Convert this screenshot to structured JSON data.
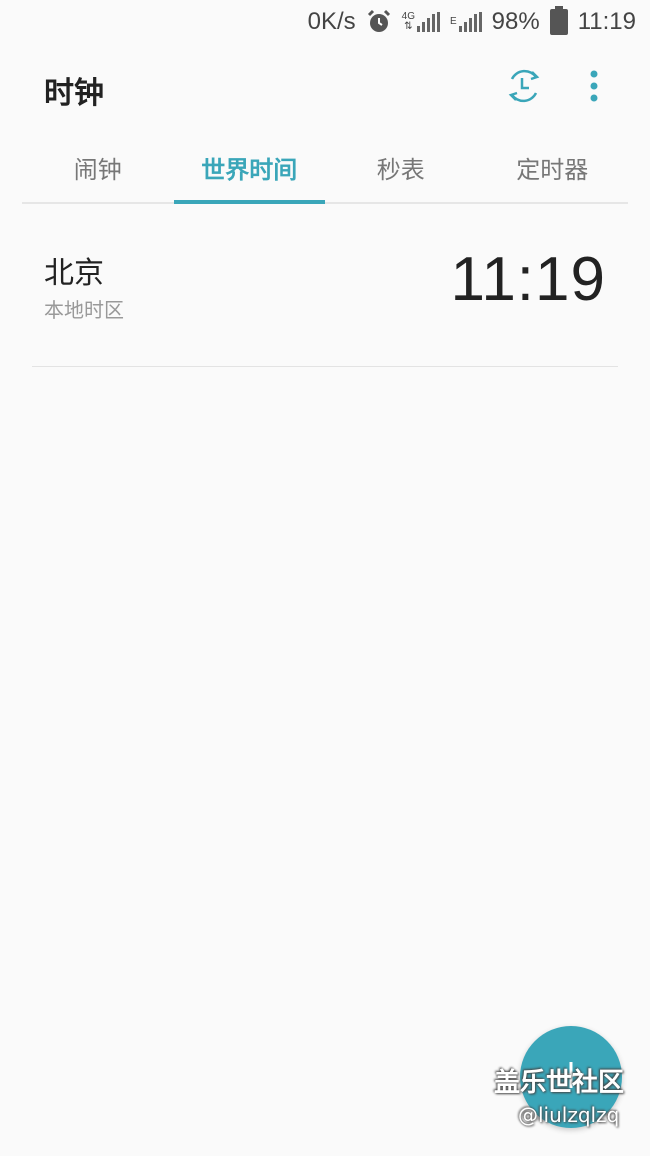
{
  "status_bar": {
    "net_speed": "0K/s",
    "network_4g": "4G",
    "network_e": "E",
    "battery": "98%",
    "time": "11:19"
  },
  "app_bar": {
    "title": "时钟"
  },
  "tabs": [
    {
      "label": "闹钟",
      "active": false
    },
    {
      "label": "世界时间",
      "active": true
    },
    {
      "label": "秒表",
      "active": false
    },
    {
      "label": "定时器",
      "active": false
    }
  ],
  "cities": [
    {
      "name": "北京",
      "subtitle": "本地时区",
      "time": "11:19"
    }
  ],
  "watermark": {
    "line1": "盖乐世社区",
    "line2": "@liulzqlzq"
  },
  "colors": {
    "accent": "#3aa6b9",
    "background": "#fafafa"
  }
}
